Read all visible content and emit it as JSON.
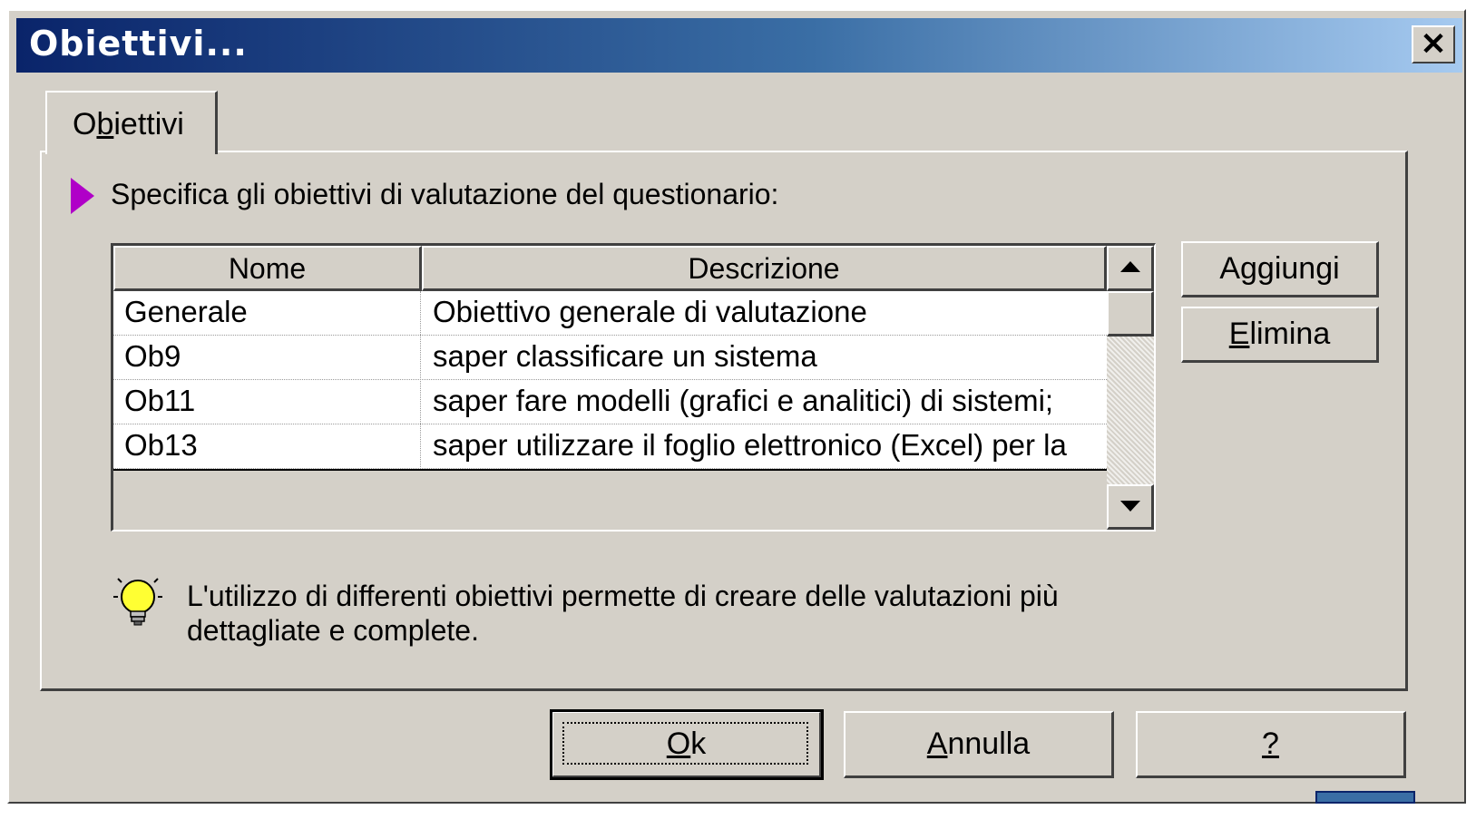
{
  "window": {
    "title": "Obiettivi...",
    "close_symbol": "✕"
  },
  "tabs": [
    {
      "label_prefix": "O",
      "label_underlined": "b",
      "label_suffix": "iettivi"
    }
  ],
  "instruction": "Specifica gli obiettivi di valutazione del questionario:",
  "table": {
    "columns": [
      "Nome",
      "Descrizione"
    ],
    "rows": [
      {
        "nome": "Generale",
        "descrizione": "Obiettivo generale di valutazione"
      },
      {
        "nome": "Ob9",
        "descrizione": "saper classificare un sistema"
      },
      {
        "nome": "Ob11",
        "descrizione": "saper fare modelli (grafici e analitici) di sistemi;"
      },
      {
        "nome": "Ob13",
        "descrizione": "saper utilizzare il foglio elettronico (Excel) per la"
      }
    ]
  },
  "side_buttons": {
    "add_label": "Aggiungi",
    "delete_prefix": "",
    "delete_underlined": "E",
    "delete_suffix": "limina"
  },
  "tip": "L'utilizzo di differenti obiettivi permette di creare delle valutazioni più dettagliate e complete.",
  "footer_buttons": {
    "ok_underlined": "O",
    "ok_suffix": "k",
    "cancel_underlined": "A",
    "cancel_suffix": "nnulla",
    "help_underlined": "?"
  },
  "colors": {
    "titlebar_start": "#0a246a",
    "titlebar_end": "#a6caf0",
    "face": "#d4d0c8",
    "instruction_arrow": "#b000c8",
    "bulb": "#ffff33"
  },
  "icons": [
    "close-icon",
    "instruction-arrow-icon",
    "scroll-up-icon",
    "scroll-down-icon",
    "lightbulb-icon"
  ]
}
